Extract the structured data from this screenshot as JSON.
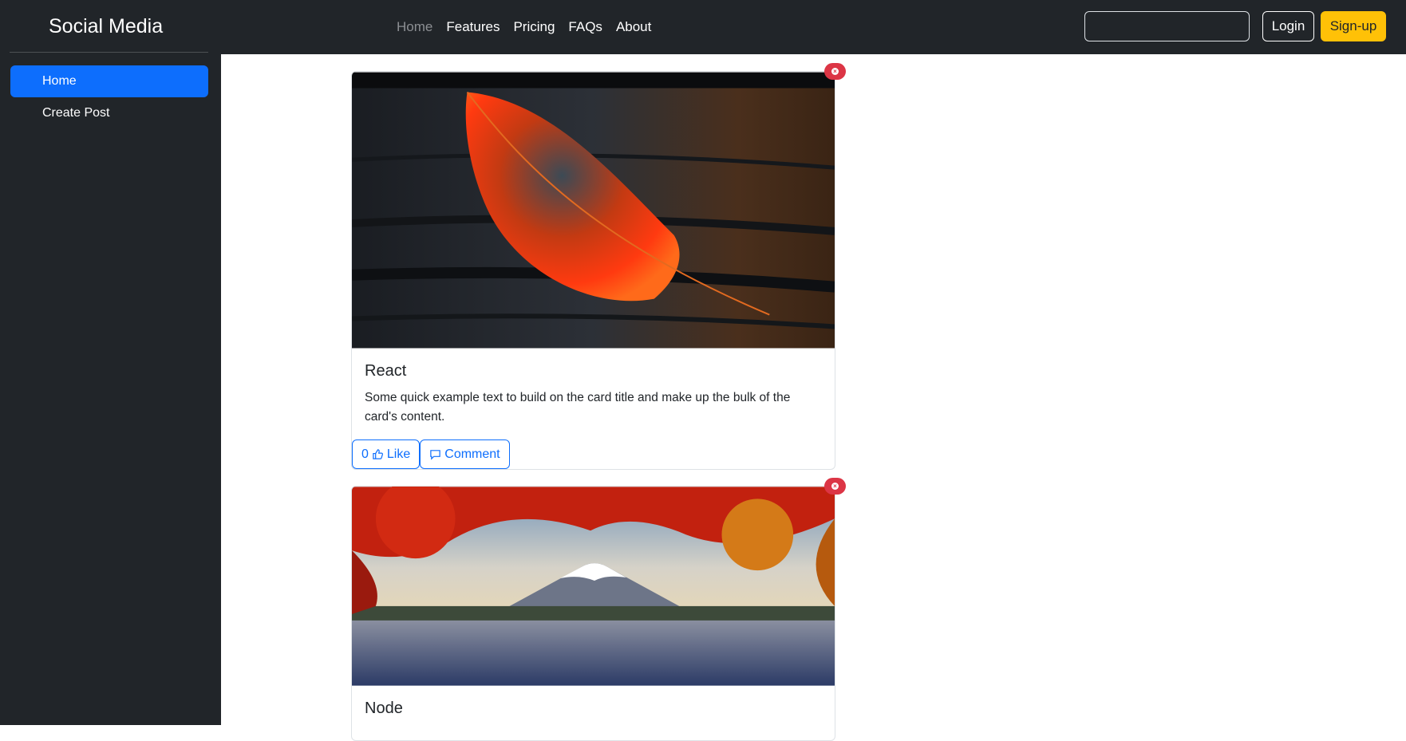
{
  "header": {
    "brand": "Social Media",
    "nav": [
      "Home",
      "Features",
      "Pricing",
      "FAQs",
      "About"
    ],
    "active_nav": "Home",
    "search_value": "",
    "login_label": "Login",
    "signup_label": "Sign-up"
  },
  "sidebar": {
    "items": [
      {
        "label": "Home",
        "active": true
      },
      {
        "label": "Create Post",
        "active": false
      }
    ]
  },
  "posts": [
    {
      "title": "React",
      "body": "Some quick example text to build on the card title and make up the bulk of the card's content.",
      "likes": "0",
      "like_label": "Like",
      "comment_label": "Comment",
      "image": "autumn-leaf-on-wood"
    },
    {
      "title": "Node",
      "image": "mount-fuji-autumn-lake"
    }
  ],
  "colors": {
    "dark": "#212529",
    "primary": "#0d6efd",
    "warning": "#ffc107",
    "danger": "#dc3545"
  }
}
